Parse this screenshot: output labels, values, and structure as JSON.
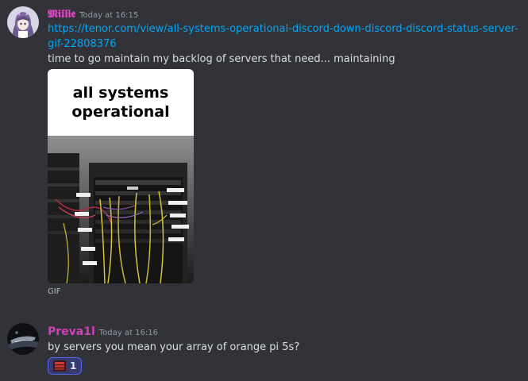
{
  "colors": {
    "background": "#313338",
    "link": "#00a8fc",
    "username_1": "#e045c4",
    "username_2": "#d23fb6",
    "timestamp": "#949ba4",
    "reaction_bg": "#373a6d",
    "reaction_border": "#5865f2"
  },
  "messages": [
    {
      "username": "𝕸𝖎𝖑𝖑𝖎𝖊",
      "timestamp": "Today at 16:15",
      "avatar_icon": "anime-girl-avatar",
      "link_text": "https://tenor.com/view/all-systems-operational-discord-down-discord-discord-status-server-gif-22808376",
      "text": "time to go maintain my backlog of servers that need... maintaining",
      "gif": {
        "caption": "all systems operational",
        "label": "GIF"
      }
    },
    {
      "username": "Preva1l",
      "timestamp": "Today at 16:16",
      "avatar_icon": "dark-abstract-avatar",
      "text": "by servers you mean your array of orange pi 5s?",
      "reactions": [
        {
          "emoji": "server-rack-emoji",
          "count": "1"
        }
      ]
    }
  ]
}
